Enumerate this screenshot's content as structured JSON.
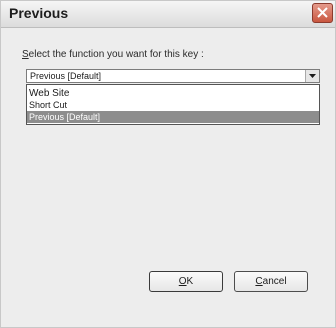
{
  "window": {
    "title": "Previous"
  },
  "prompt": {
    "accel": "S",
    "rest": "elect the function you want for this key :"
  },
  "combo": {
    "selected": "Previous [Default]"
  },
  "dropdown": {
    "options": [
      "Web Site",
      "Short Cut",
      "Previous [Default]"
    ],
    "highlighted_index": 2
  },
  "buttons": {
    "ok_accel": "O",
    "ok_rest": "K",
    "cancel_accel": "C",
    "cancel_rest": "ancel"
  },
  "icons": {
    "close": "close-icon",
    "dropdown_arrow": "chevron-down-icon"
  },
  "colors": {
    "close_button": "#c9563f",
    "highlight": "#8d8d8d"
  }
}
